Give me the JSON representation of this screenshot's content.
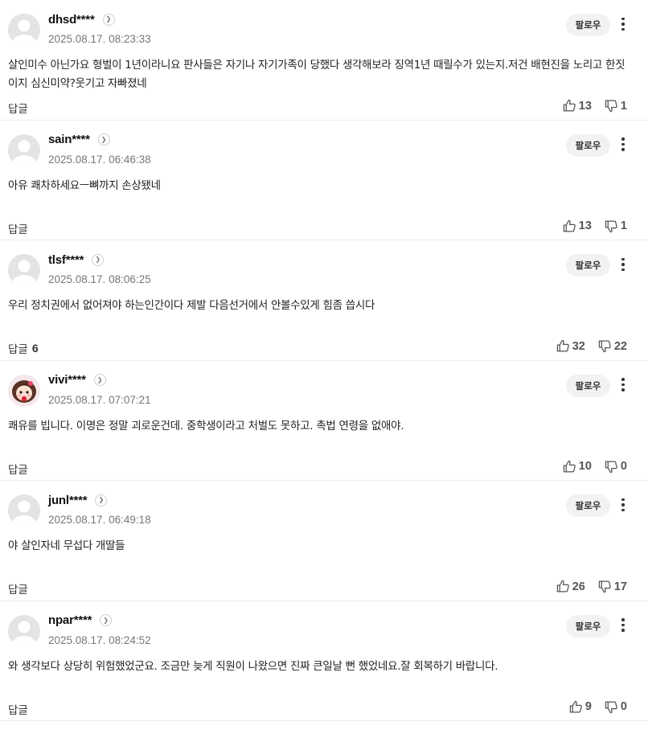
{
  "follow_label": "팔로우",
  "reply_label": "답글",
  "comments": [
    {
      "nickname": "dhsd****",
      "timestamp": "2025.08.17. 08:23:33",
      "text": "살인미수 아닌가요 형벌이 1년이라니요 판사들은 자기나 자기가족이 당했다 생각해보라 징역1년 때릴수가 있는지.저건 배현진을 노리고 한짓이지 심신미약?웃기고 자빠졌네",
      "reply_count": "",
      "likes": "13",
      "dislikes": "1"
    },
    {
      "nickname": "sain****",
      "timestamp": "2025.08.17. 06:46:38",
      "text": "아유 쾌차하세요ㅡ뼈까지 손상됐네",
      "reply_count": "",
      "likes": "13",
      "dislikes": "1"
    },
    {
      "nickname": "tlsf****",
      "timestamp": "2025.08.17. 08:06:25",
      "text": "우리 정치권에서 없어져야 하는인간이다 제발 다음선거에서 안볼수있게 힘좀 씁시다",
      "reply_count": "6",
      "likes": "32",
      "dislikes": "22"
    },
    {
      "nickname": "vivi****",
      "timestamp": "2025.08.17. 07:07:21",
      "text": "쾌유를 빕니다. 이명은 정말 괴로운건데. 중학생이라고 처벌도 못하고. 촉법 연령을 없애야.",
      "reply_count": "",
      "likes": "10",
      "dislikes": "0"
    },
    {
      "nickname": "junl****",
      "timestamp": "2025.08.17. 06:49:18",
      "text": "야 살인자네 무섭다 개딸들",
      "reply_count": "",
      "likes": "26",
      "dislikes": "17"
    },
    {
      "nickname": "npar****",
      "timestamp": "2025.08.17. 08:24:52",
      "text": "와 생각보다 상당히 위험했었군요. 조금만 늦게 직원이 나왔으면 진짜 큰일날 뻔 했었네요.잘 회복하기 바랍니다.",
      "reply_count": "",
      "likes": "9",
      "dislikes": "0"
    }
  ],
  "icons": {
    "avatar_default": "default-profile-icon",
    "avatar_custom": "character-profile-image",
    "like": "thumbs-up-icon",
    "dislike": "thumbs-down-icon",
    "more": "kebab-menu-icon",
    "profile_link": "chevron-right-icon"
  },
  "colors": {
    "follow_bg": "#f2f2f2",
    "divider": "#ececec",
    "timestamp": "#777777"
  }
}
